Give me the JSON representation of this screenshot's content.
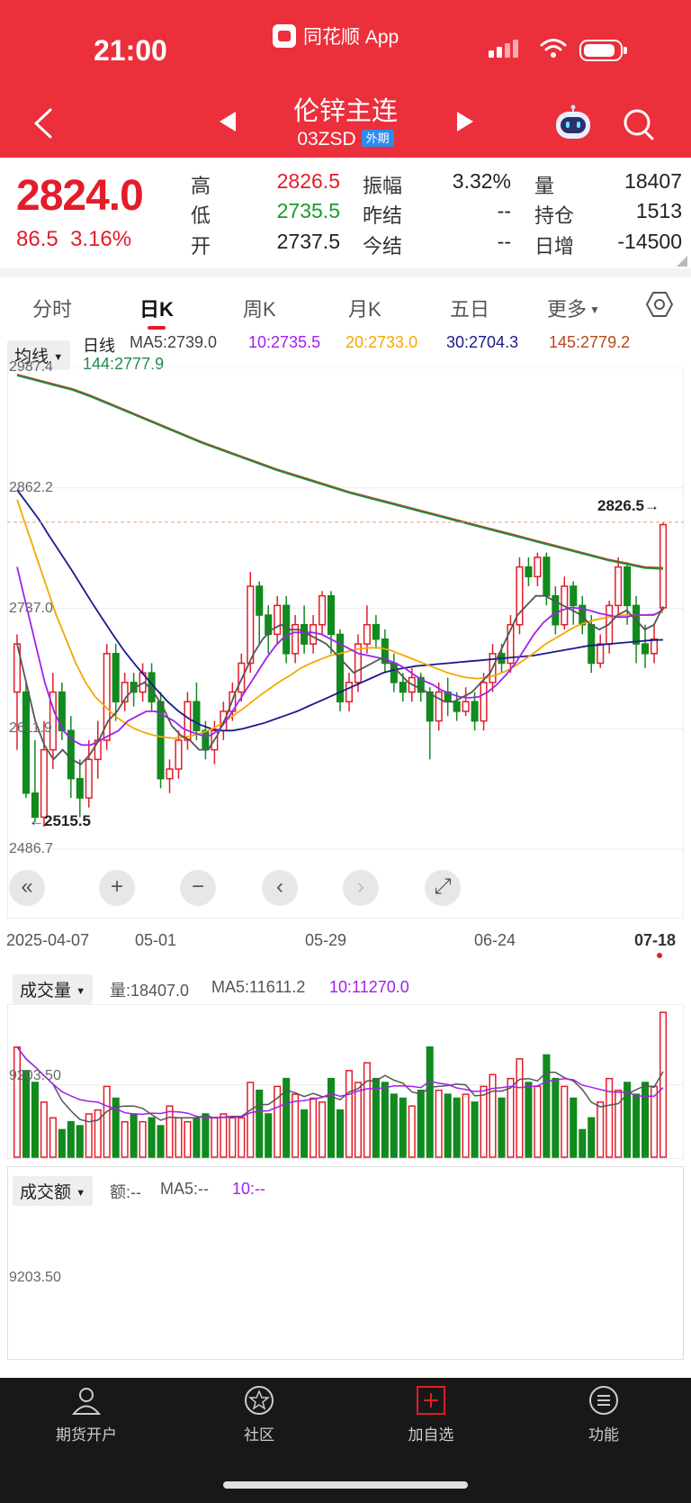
{
  "status_bar": {
    "time": "21:00",
    "app_name": "同花顺 App"
  },
  "header": {
    "title": "伦锌主连",
    "code": "03ZSD",
    "market_tag": "外期"
  },
  "quote": {
    "last_price": "2824.0",
    "change": "86.5",
    "change_pct": "3.16%",
    "high_label": "高",
    "high": "2826.5",
    "low_label": "低",
    "low": "2735.5",
    "open_label": "开",
    "open": "2737.5",
    "amplitude_label": "振幅",
    "amplitude": "3.32%",
    "prev_settle_label": "昨结",
    "prev_settle": "--",
    "settle_label": "今结",
    "settle": "--",
    "volume_label": "量",
    "volume": "18407",
    "open_interest_label": "持仓",
    "open_interest": "1513",
    "daily_change_label": "日增",
    "daily_change": "-14500"
  },
  "tabs": [
    {
      "label": "分时"
    },
    {
      "label": "日K"
    },
    {
      "label": "周K"
    },
    {
      "label": "月K"
    },
    {
      "label": "五日"
    },
    {
      "label": "更多"
    }
  ],
  "active_tab": "日K",
  "ma_legend": {
    "dropdown": "均线",
    "period": "日线",
    "ma5": "MA5:2739.0",
    "ma10": "10:2735.5",
    "ma20": "20:2733.0",
    "ma30": "30:2704.3",
    "ma145": "145:2779.2",
    "ma144": "144:2777.9"
  },
  "colors": {
    "up": "#e41c2a",
    "down": "#118a1e",
    "header": "#eb2f3b",
    "ma5": "#555555",
    "ma10": "#a020f0",
    "ma20": "#f4a800",
    "ma30": "#1a1a8c",
    "ma145": "#b5481a",
    "ma144": "#1c8a4a"
  },
  "chart_controls": {
    "buttons": [
      "collapse-icon",
      "zoom-in-icon",
      "zoom-out-icon",
      "scroll-left-icon",
      "scroll-right-icon",
      "fullscreen-icon"
    ]
  },
  "chart_data": {
    "type": "candlestick",
    "y_ticks": [
      "2987.4",
      "2862.2",
      "2737.0",
      "2611.9",
      "2486.7"
    ],
    "ylim": [
      2486.7,
      2987.4
    ],
    "x_ticks": [
      "2025-04-07",
      "05-01",
      "05-29",
      "06-24",
      "07-18"
    ],
    "annotations": {
      "high_marker": "2826.5→",
      "low_marker": "←2515.5"
    },
    "candles": [
      [
        2650,
        2700,
        2590,
        2710
      ],
      [
        2650,
        2545,
        2540,
        2660
      ],
      [
        2545,
        2520,
        2515,
        2600
      ],
      [
        2520,
        2590,
        2510,
        2620
      ],
      [
        2590,
        2650,
        2570,
        2670
      ],
      [
        2650,
        2610,
        2600,
        2660
      ],
      [
        2610,
        2560,
        2540,
        2625
      ],
      [
        2560,
        2540,
        2520,
        2580
      ],
      [
        2540,
        2580,
        2530,
        2600
      ],
      [
        2580,
        2600,
        2560,
        2620
      ],
      [
        2600,
        2690,
        2590,
        2700
      ],
      [
        2690,
        2640,
        2620,
        2700
      ],
      [
        2640,
        2660,
        2630,
        2670
      ],
      [
        2660,
        2650,
        2635,
        2670
      ],
      [
        2650,
        2670,
        2640,
        2680
      ],
      [
        2670,
        2640,
        2630,
        2680
      ],
      [
        2640,
        2560,
        2550,
        2650
      ],
      [
        2560,
        2570,
        2545,
        2580
      ],
      [
        2570,
        2600,
        2560,
        2610
      ],
      [
        2600,
        2640,
        2590,
        2650
      ],
      [
        2640,
        2610,
        2600,
        2660
      ],
      [
        2610,
        2590,
        2580,
        2620
      ],
      [
        2590,
        2610,
        2575,
        2620
      ],
      [
        2610,
        2630,
        2600,
        2640
      ],
      [
        2630,
        2650,
        2620,
        2660
      ],
      [
        2650,
        2680,
        2640,
        2690
      ],
      [
        2680,
        2760,
        2670,
        2775
      ],
      [
        2760,
        2730,
        2700,
        2765
      ],
      [
        2730,
        2710,
        2690,
        2740
      ],
      [
        2710,
        2740,
        2700,
        2750
      ],
      [
        2740,
        2690,
        2680,
        2750
      ],
      [
        2690,
        2720,
        2680,
        2730
      ],
      [
        2720,
        2700,
        2690,
        2740
      ],
      [
        2700,
        2720,
        2690,
        2730
      ],
      [
        2720,
        2750,
        2710,
        2755
      ],
      [
        2750,
        2710,
        2690,
        2755
      ],
      [
        2710,
        2640,
        2630,
        2715
      ],
      [
        2640,
        2660,
        2630,
        2670
      ],
      [
        2660,
        2700,
        2650,
        2710
      ],
      [
        2700,
        2720,
        2690,
        2740
      ],
      [
        2720,
        2705,
        2695,
        2730
      ],
      [
        2705,
        2680,
        2670,
        2715
      ],
      [
        2680,
        2660,
        2650,
        2690
      ],
      [
        2660,
        2650,
        2640,
        2670
      ],
      [
        2650,
        2665,
        2640,
        2675
      ],
      [
        2665,
        2650,
        2640,
        2670
      ],
      [
        2650,
        2620,
        2580,
        2655
      ],
      [
        2620,
        2650,
        2610,
        2660
      ],
      [
        2650,
        2640,
        2625,
        2665
      ],
      [
        2640,
        2630,
        2620,
        2650
      ],
      [
        2630,
        2640,
        2625,
        2655
      ],
      [
        2640,
        2620,
        2610,
        2650
      ],
      [
        2620,
        2660,
        2610,
        2670
      ],
      [
        2660,
        2690,
        2650,
        2700
      ],
      [
        2690,
        2680,
        2670,
        2700
      ],
      [
        2680,
        2720,
        2670,
        2730
      ],
      [
        2720,
        2780,
        2710,
        2790
      ],
      [
        2780,
        2770,
        2760,
        2790
      ],
      [
        2770,
        2790,
        2760,
        2795
      ],
      [
        2790,
        2750,
        2740,
        2795
      ],
      [
        2750,
        2720,
        2710,
        2760
      ],
      [
        2720,
        2760,
        2715,
        2770
      ],
      [
        2760,
        2740,
        2720,
        2765
      ],
      [
        2740,
        2720,
        2710,
        2750
      ],
      [
        2720,
        2680,
        2670,
        2730
      ],
      [
        2680,
        2700,
        2675,
        2710
      ],
      [
        2700,
        2740,
        2690,
        2745
      ],
      [
        2740,
        2780,
        2730,
        2790
      ],
      [
        2780,
        2740,
        2720,
        2785
      ],
      [
        2740,
        2700,
        2680,
        2750
      ],
      [
        2700,
        2690,
        2675,
        2720
      ],
      [
        2690,
        2705,
        2680,
        2720
      ],
      [
        2737.5,
        2824.0,
        2735.5,
        2826.5
      ]
    ],
    "ma5": [
      2700,
      2660,
      2620,
      2595,
      2580,
      2590,
      2580,
      2575,
      2585,
      2600,
      2620,
      2630,
      2645,
      2655,
      2660,
      2650,
      2635,
      2615,
      2605,
      2600,
      2590,
      2590,
      2605,
      2625,
      2650,
      2670,
      2690,
      2705,
      2715,
      2720,
      2715,
      2715,
      2710,
      2705,
      2700,
      2690,
      2680,
      2670,
      2675,
      2680,
      2685,
      2680,
      2670,
      2660,
      2655,
      2650,
      2645,
      2640,
      2640,
      2645,
      2650,
      2660,
      2670,
      2690,
      2710,
      2730,
      2740,
      2750,
      2750,
      2745,
      2740,
      2735,
      2730,
      2720,
      2715,
      2720,
      2730,
      2735,
      2725,
      2715,
      2720,
      2739
    ],
    "ma10": [
      2780,
      2740,
      2700,
      2660,
      2630,
      2610,
      2600,
      2595,
      2595,
      2600,
      2605,
      2610,
      2620,
      2625,
      2630,
      2630,
      2625,
      2620,
      2612,
      2608,
      2605,
      2605,
      2612,
      2625,
      2640,
      2655,
      2670,
      2685,
      2698,
      2708,
      2712,
      2712,
      2712,
      2710,
      2705,
      2700,
      2695,
      2690,
      2688,
      2686,
      2684,
      2680,
      2675,
      2668,
      2662,
      2658,
      2652,
      2648,
      2645,
      2644,
      2645,
      2650,
      2658,
      2668,
      2680,
      2695,
      2710,
      2722,
      2730,
      2735,
      2738,
      2737,
      2735,
      2732,
      2730,
      2728,
      2728,
      2730,
      2730,
      2730,
      2735.5
    ],
    "ma20": [
      2850,
      2820,
      2790,
      2760,
      2730,
      2705,
      2680,
      2660,
      2645,
      2635,
      2625,
      2618,
      2612,
      2608,
      2605,
      2603,
      2602,
      2603,
      2605,
      2608,
      2612,
      2618,
      2625,
      2632,
      2640,
      2648,
      2655,
      2662,
      2668,
      2675,
      2680,
      2684,
      2688,
      2690,
      2693,
      2695,
      2696,
      2696,
      2694,
      2690,
      2686,
      2682,
      2678,
      2674,
      2670,
      2667,
      2665,
      2664,
      2665,
      2668,
      2672,
      2678,
      2685,
      2692,
      2700,
      2706,
      2712,
      2718,
      2722,
      2725,
      2727,
      2729,
      2730,
      2730,
      2730,
      2731,
      2733
    ],
    "ma30": [
      2860,
      2845,
      2830,
      2812,
      2795,
      2778,
      2760,
      2742,
      2725,
      2708,
      2692,
      2678,
      2665,
      2652,
      2640,
      2630,
      2622,
      2616,
      2612,
      2610,
      2610,
      2612,
      2615,
      2618,
      2622,
      2626,
      2630,
      2635,
      2640,
      2645,
      2650,
      2655,
      2660,
      2665,
      2670,
      2673,
      2675,
      2677,
      2678,
      2679,
      2680,
      2681,
      2682,
      2683,
      2684,
      2685,
      2686,
      2687,
      2688,
      2690,
      2692,
      2694,
      2696,
      2698,
      2699,
      2700,
      2701,
      2702,
      2703,
      2704,
      2704.3
    ],
    "ma145": [
      2980,
      2975,
      2970,
      2965,
      2958,
      2950,
      2942,
      2934,
      2926,
      2918,
      2910,
      2903,
      2896,
      2889,
      2882,
      2876,
      2870,
      2864,
      2858,
      2853,
      2848,
      2843,
      2838,
      2833,
      2828,
      2823,
      2818,
      2813,
      2808,
      2803,
      2798,
      2793,
      2788,
      2784,
      2780,
      2779.2
    ],
    "ma144": [
      2979,
      2974,
      2969,
      2964,
      2957,
      2949,
      2941,
      2933,
      2925,
      2917,
      2909,
      2902,
      2895,
      2888,
      2881,
      2875,
      2869,
      2863,
      2857,
      2852,
      2847,
      2842,
      2837,
      2832,
      2827,
      2822,
      2817,
      2812,
      2807,
      2802,
      2797,
      2792,
      2787,
      2783,
      2779,
      2777.9
    ],
    "volume": {
      "dropdown": "成交量",
      "label": "量:18407.0",
      "ma5": "MA5:11611.2",
      "ma10": "10:11270.0",
      "tick": "9203.50",
      "values": [
        14000,
        11000,
        9500,
        7000,
        5000,
        3500,
        4500,
        4000,
        5500,
        6000,
        9000,
        7500,
        4500,
        5500,
        4500,
        5000,
        4000,
        6500,
        5000,
        4500,
        5000,
        5500,
        5000,
        5500,
        5000,
        5000,
        9500,
        8500,
        5500,
        9000,
        10000,
        8000,
        6000,
        7500,
        7000,
        10000,
        6000,
        11000,
        9500,
        12000,
        10000,
        9500,
        8000,
        7500,
        6500,
        8500,
        14000,
        8500,
        8000,
        7500,
        8000,
        7000,
        9000,
        10500,
        7500,
        10000,
        12500,
        9500,
        9000,
        13000,
        10000,
        9000,
        7500,
        3500,
        5000,
        7000,
        10000,
        8500,
        9500,
        8000,
        9500,
        9000,
        18407
      ]
    },
    "amount": {
      "dropdown": "成交额",
      "label": "额:--",
      "ma5": "MA5:--",
      "ma10": "10:--",
      "tick": "9203.50"
    }
  },
  "bottom_nav": [
    {
      "label": "期货开户",
      "icon": "user-icon"
    },
    {
      "label": "社区",
      "icon": "star-icon"
    },
    {
      "label": "加自选",
      "icon": "add-watchlist-icon"
    },
    {
      "label": "功能",
      "icon": "menu-icon"
    }
  ]
}
